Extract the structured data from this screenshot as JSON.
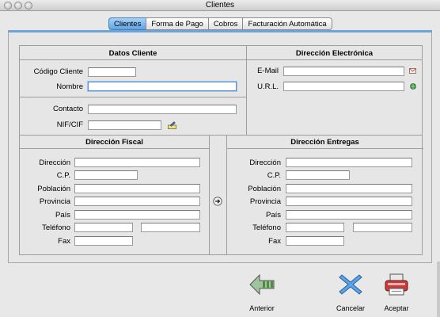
{
  "window": {
    "title": "Clientes"
  },
  "tabs": [
    {
      "label": "Clientes",
      "active": true
    },
    {
      "label": "Forma de Pago",
      "active": false
    },
    {
      "label": "Cobros",
      "active": false
    },
    {
      "label": "Facturación Automática",
      "active": false
    }
  ],
  "datos_cliente": {
    "title": "Datos Cliente",
    "codigo_label": "Código Cliente",
    "codigo_value": "",
    "nombre_label": "Nombre",
    "nombre_value": "",
    "contacto_label": "Contacto",
    "contacto_value": "",
    "nif_label": "NIF/CIF",
    "nif_value": ""
  },
  "direccion_electronica": {
    "title": "Dirección Electrónica",
    "email_label": "E-Mail",
    "email_value": "",
    "url_label": "U.R.L.",
    "url_value": ""
  },
  "direccion_fiscal": {
    "title": "Dirección Fiscal",
    "direccion_label": "Dirección",
    "cp_label": "C.P.",
    "poblacion_label": "Población",
    "provincia_label": "Provincia",
    "pais_label": "País",
    "telefono_label": "Teléfono",
    "fax_label": "Fax"
  },
  "direccion_entregas": {
    "title": "Dirección Entregas",
    "direccion_label": "Dirección",
    "cp_label": "C.P.",
    "poblacion_label": "Población",
    "provincia_label": "Provincia",
    "pais_label": "País",
    "telefono_label": "Teléfono",
    "fax_label": "Fax"
  },
  "buttons": {
    "anterior": "Anterior",
    "cancelar": "Cancelar",
    "aceptar": "Aceptar"
  },
  "icons": {
    "email": "email-icon",
    "url": "globe-icon",
    "nif": "edit-pencil-icon",
    "copy": "arrow-right-circle-icon",
    "anterior": "back-arrow-icon",
    "cancelar": "cancel-x-icon",
    "aceptar": "accept-printer-icon"
  },
  "colors": {
    "tab_active": "#6aa9e8",
    "panel_accent": "#6ea3d8"
  }
}
